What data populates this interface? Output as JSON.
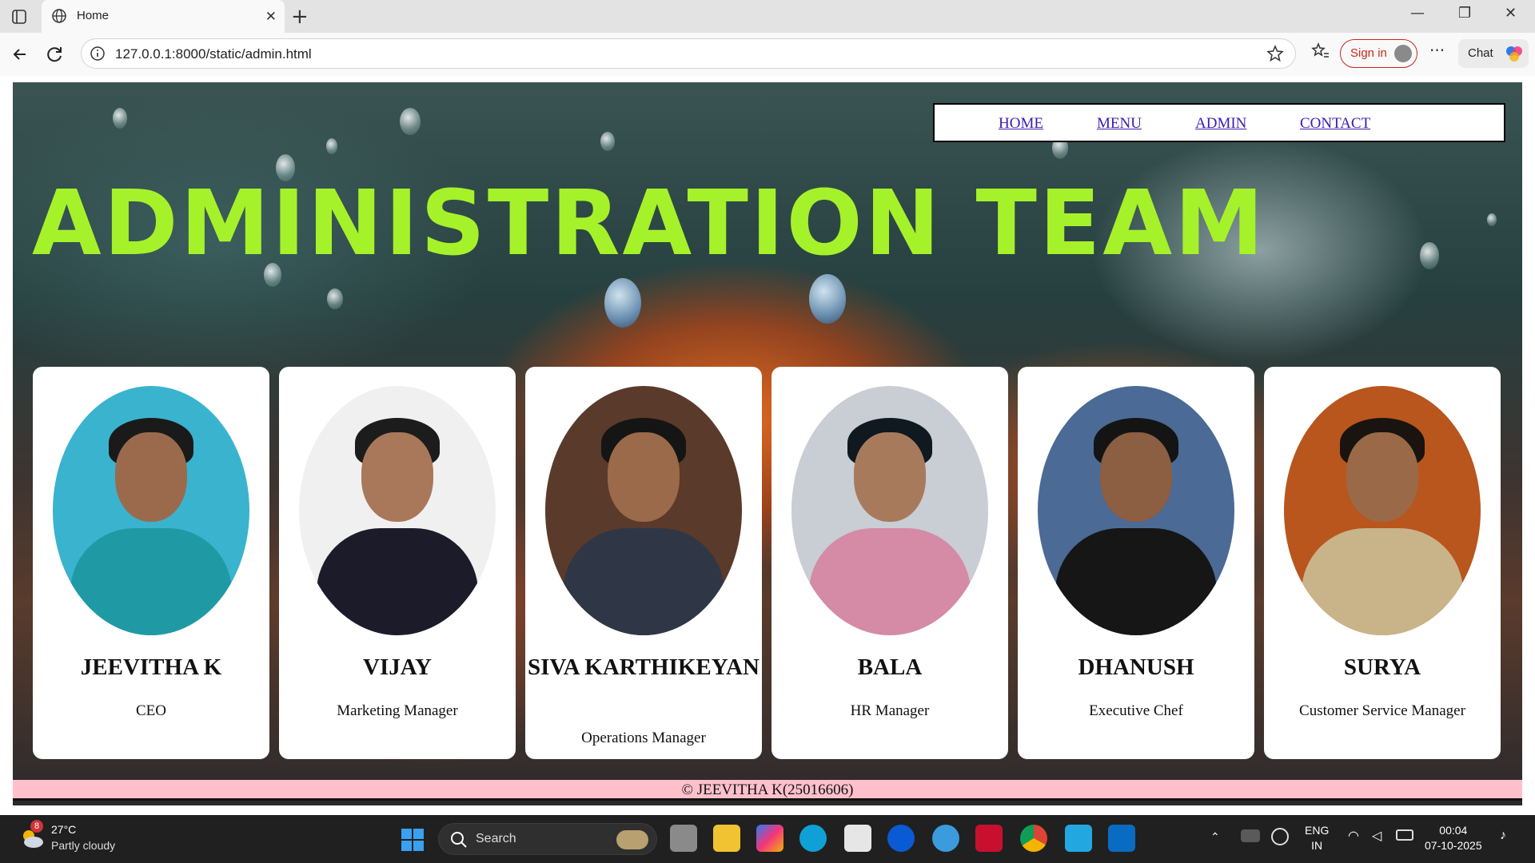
{
  "browser": {
    "tab_title": "Home",
    "url": "127.0.0.1:8000/static/admin.html",
    "signin_label": "Sign in",
    "chat_label": "Chat"
  },
  "nav": {
    "items": [
      "HOME",
      "MENU",
      "ADMIN",
      "CONTACT"
    ]
  },
  "page": {
    "heading": "ADMINISTRATION TEAM",
    "footer": "© JEEVITHA K(25016606)"
  },
  "team": [
    {
      "name": "JEEVITHA K",
      "role": "CEO"
    },
    {
      "name": "VIJAY",
      "role": "Marketing Manager"
    },
    {
      "name": "SIVA KARTHIKEYAN",
      "role": "Operations Manager"
    },
    {
      "name": "BALA",
      "role": "HR Manager"
    },
    {
      "name": "DHANUSH",
      "role": "Executive Chef"
    },
    {
      "name": "SURYA",
      "role": "Customer Service Manager"
    }
  ],
  "taskbar": {
    "weather_temp": "27°C",
    "weather_cond": "Partly cloudy",
    "weather_badge": "8",
    "search_label": "Search",
    "lang_1": "ENG",
    "lang_2": "IN",
    "time": "00:04",
    "date": "07-10-2025"
  },
  "colors": {
    "heading": "#a6f22a",
    "link": "#3a1bb3",
    "footer_bg": "#ffc0cb",
    "signin_accent": "#c42b1c"
  }
}
